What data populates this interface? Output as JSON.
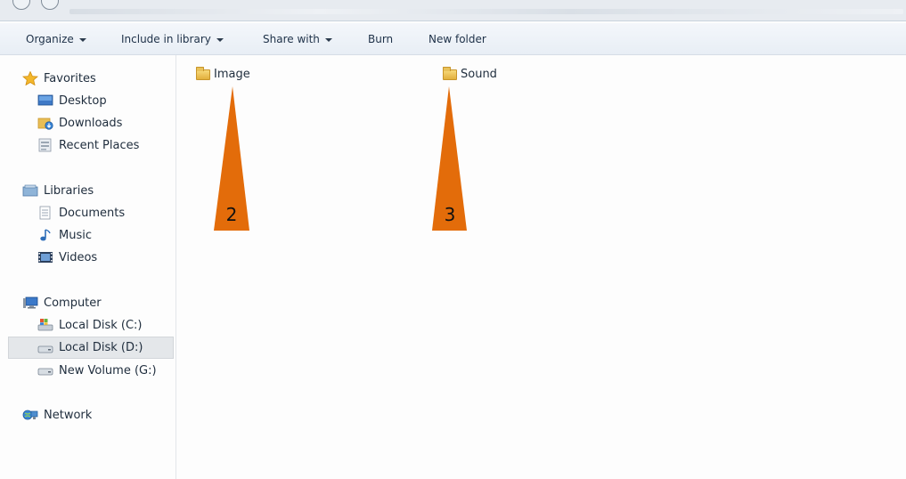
{
  "toolbar": {
    "organize": "Organize",
    "include_in_library": "Include in library",
    "share_with": "Share with",
    "burn": "Burn",
    "new_folder": "New folder"
  },
  "sidebar": {
    "favorites": {
      "header": "Favorites",
      "items": [
        "Desktop",
        "Downloads",
        "Recent Places"
      ]
    },
    "libraries": {
      "header": "Libraries",
      "items": [
        "Documents",
        "Music",
        "Videos"
      ]
    },
    "computer": {
      "header": "Computer",
      "items": [
        "Local Disk (C:)",
        "Local Disk (D:)",
        "New Volume (G:)"
      ],
      "selected": "Local Disk (D:)"
    },
    "network": {
      "header": "Network"
    }
  },
  "main": {
    "folders": [
      "Image",
      "Sound"
    ]
  },
  "annotations": {
    "image_label": "2",
    "sound_label": "3",
    "color": "#E36C0A"
  }
}
